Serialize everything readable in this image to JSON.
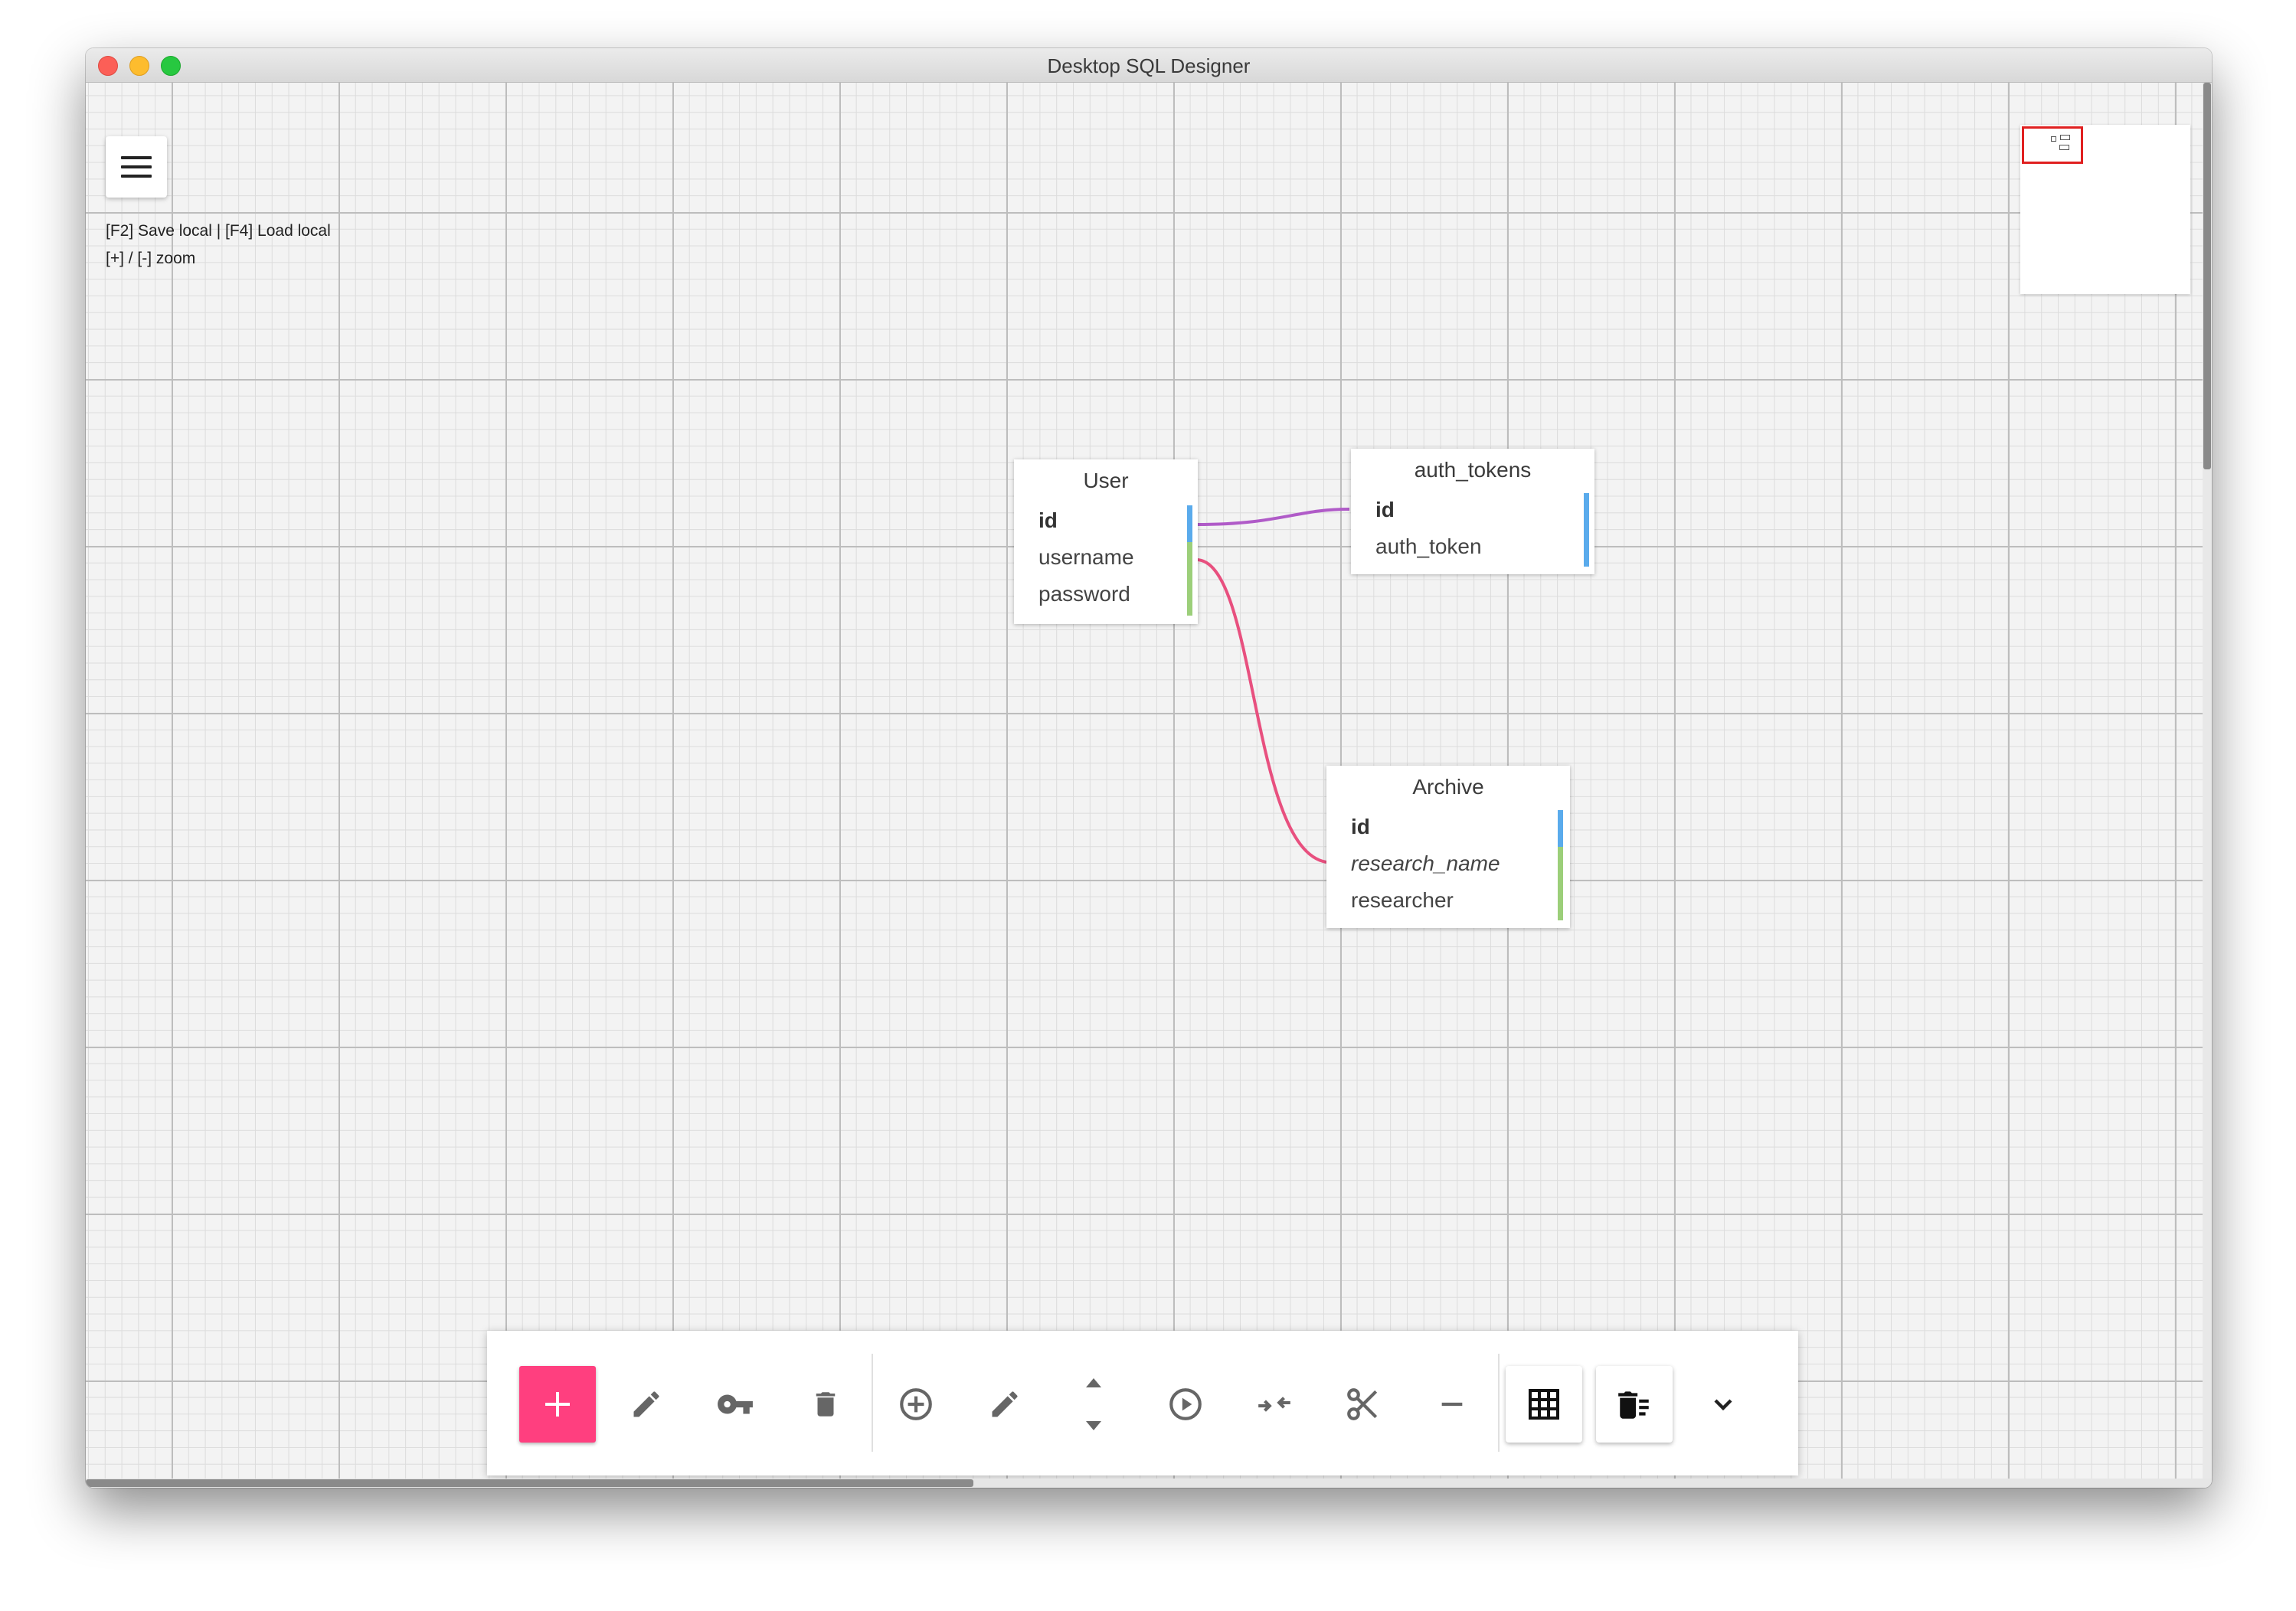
{
  "window": {
    "title": "Desktop SQL Designer"
  },
  "hints": {
    "line1": "[F2] Save local | [F4] Load local",
    "line2": "[+] / [-] zoom"
  },
  "tables": {
    "user": {
      "name": "User",
      "columns": [
        "id",
        "username",
        "password"
      ]
    },
    "auth_tokens": {
      "name": "auth_tokens",
      "columns": [
        "id",
        "auth_token"
      ]
    },
    "archive": {
      "name": "Archive",
      "columns": [
        "id",
        "research_name",
        "researcher"
      ]
    }
  },
  "relations": [
    {
      "from": "User.id",
      "to": "auth_tokens.id",
      "color": "#b05bc8"
    },
    {
      "from": "User.username",
      "to": "Archive",
      "color": "#e8507f"
    }
  ],
  "colors": {
    "accent": "#ff3f7f",
    "pk_marker": "#5aabec",
    "field_marker": "#9ccf7a"
  },
  "toolbar": {
    "icons": [
      "add-table-icon",
      "edit-table-icon",
      "key-icon",
      "delete-table-icon",
      "add-column-icon",
      "edit-column-icon",
      "move-column-icon",
      "play-icon",
      "merge-icon",
      "cut-icon",
      "remove-icon",
      "grid-icon",
      "clear-all-icon",
      "chevron-down-icon"
    ]
  }
}
